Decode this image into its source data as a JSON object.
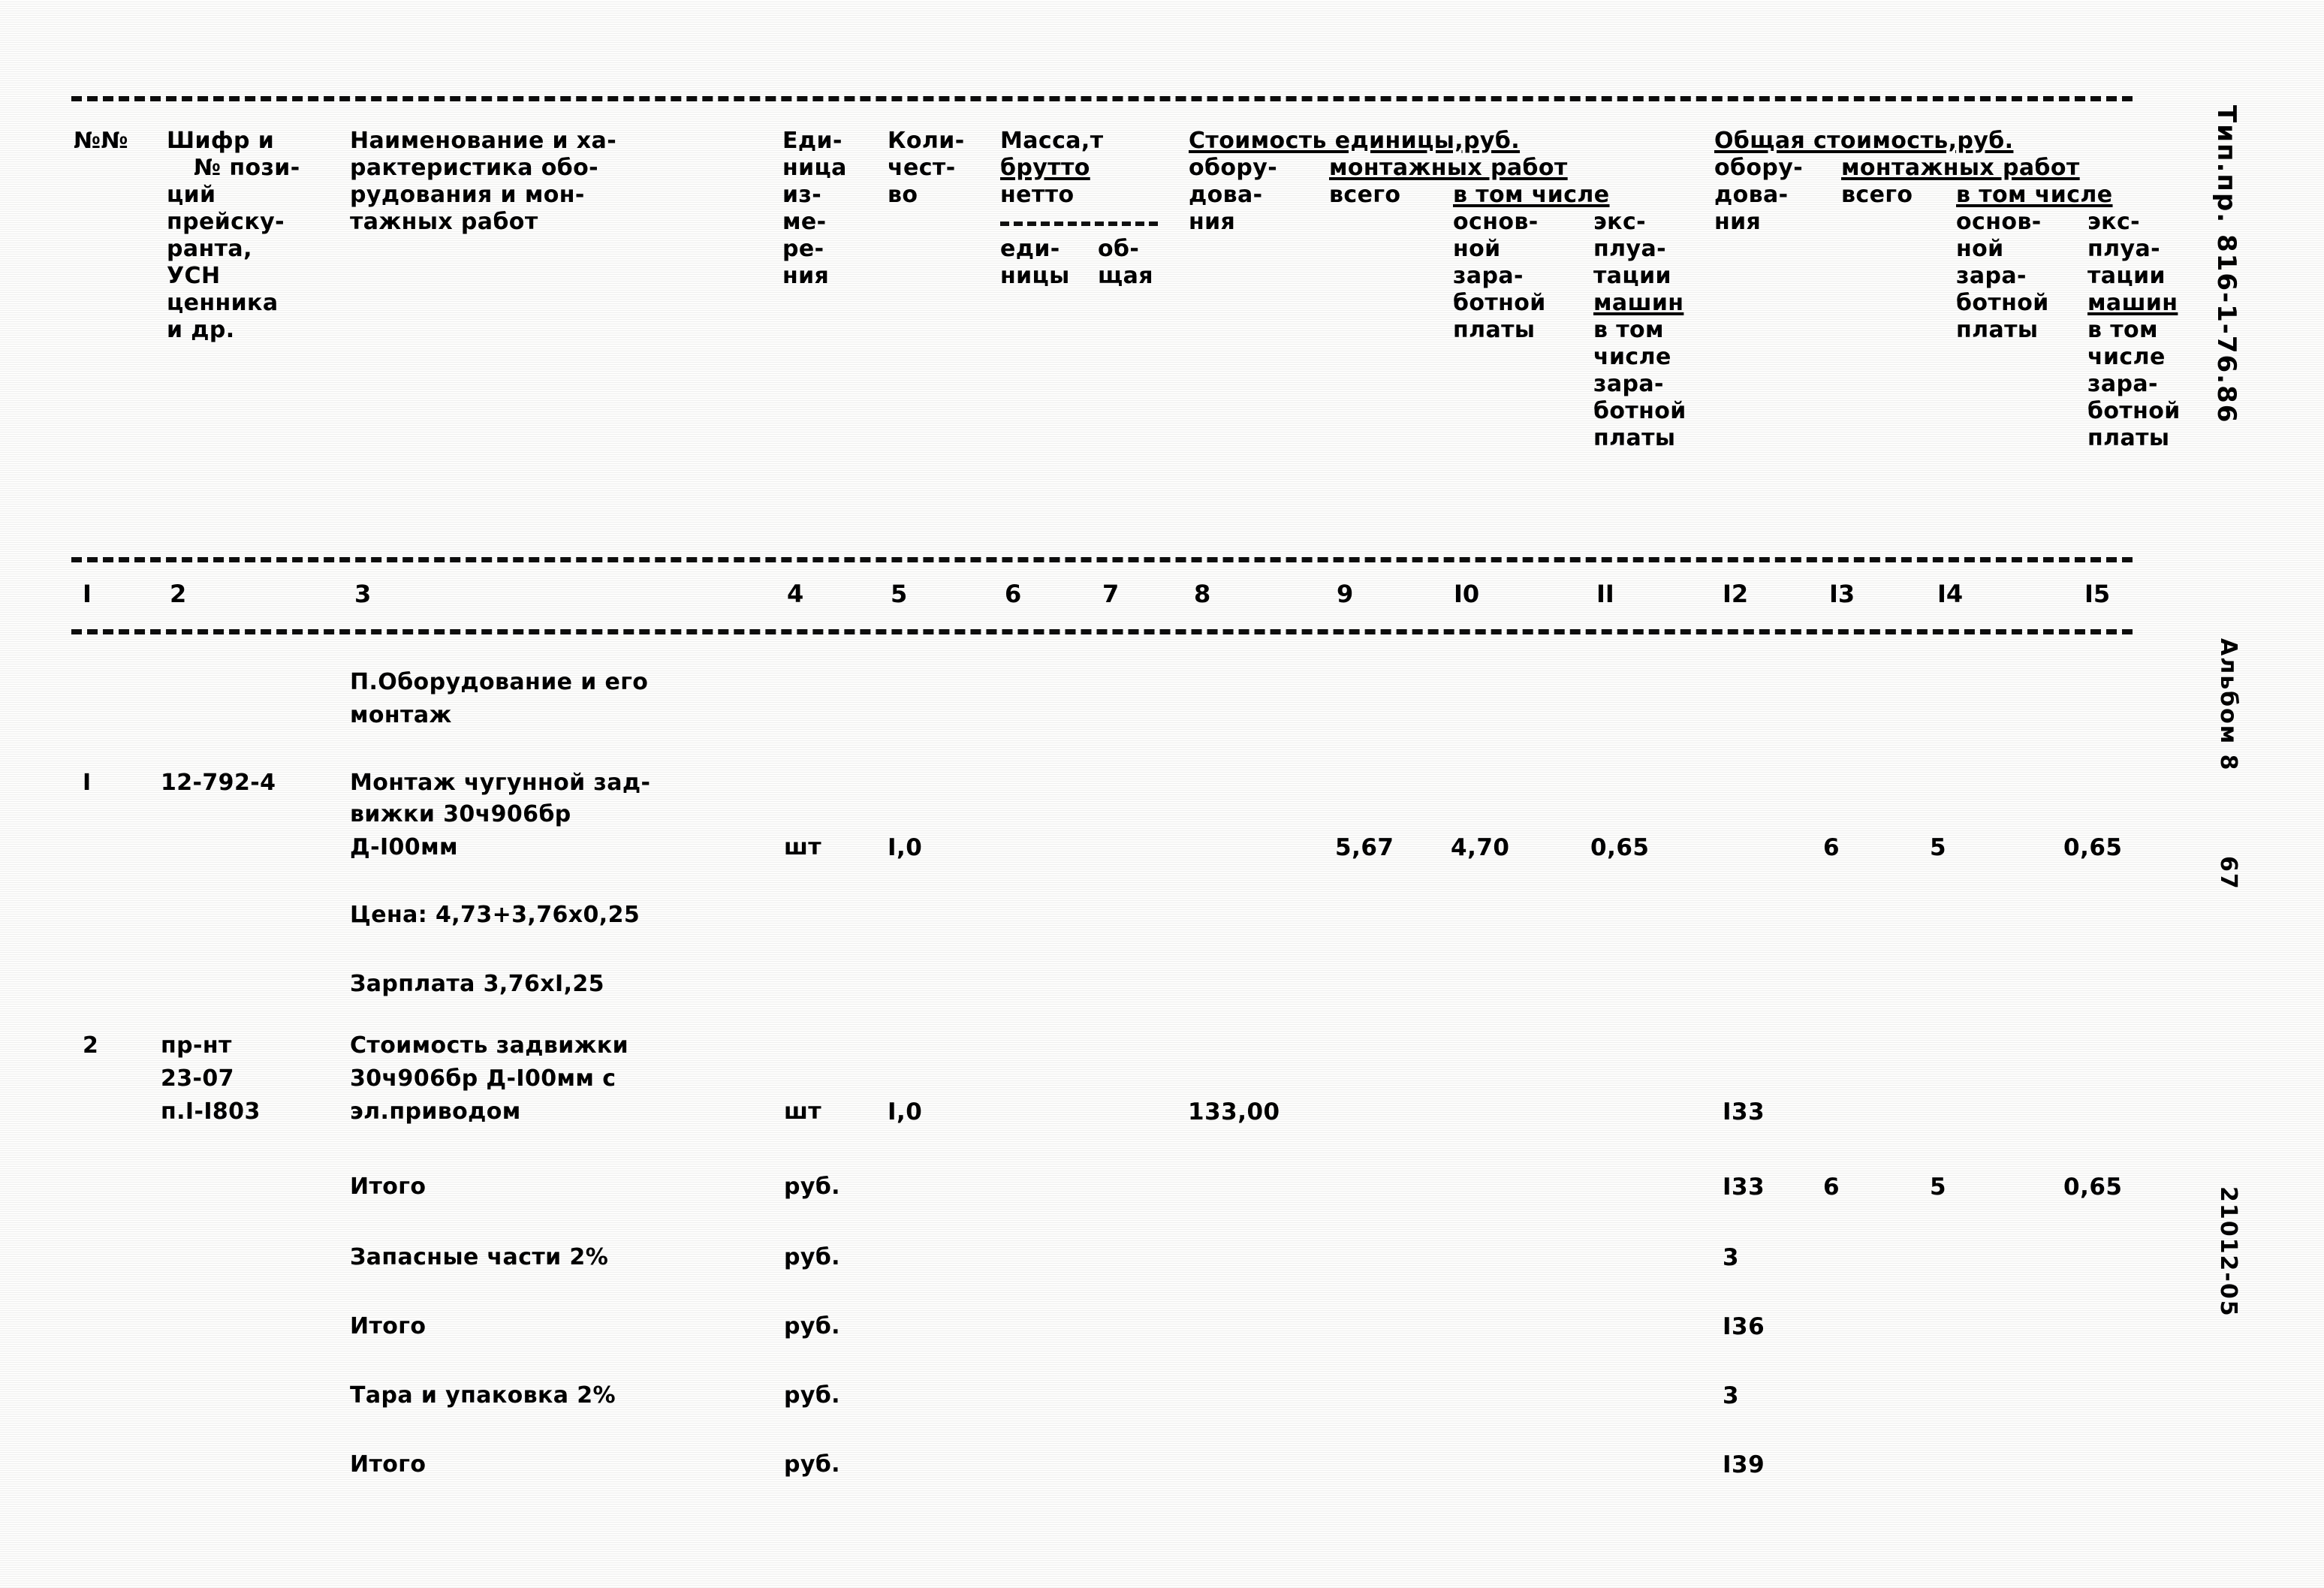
{
  "document": {
    "margin_right": {
      "type_project": "Тип.пр. 816-1-76.86",
      "album": "Альбом 8",
      "page_number": "67",
      "drawing_code": "21012-05"
    }
  },
  "table": {
    "header": {
      "col1": "№№",
      "col2": [
        "Шифр и",
        "№ пози-",
        "ций",
        "прейску-",
        "ранта,",
        "УСН",
        "ценника",
        "и др."
      ],
      "col3": [
        "Наименование и ха-",
        "рактеристика обо-",
        "рудования и мон-",
        "тажных работ"
      ],
      "col4": [
        "Еди-",
        "ница",
        "из-",
        "ме-",
        "ре-",
        "ния"
      ],
      "col5": [
        "Коли-",
        "чест-",
        "во"
      ],
      "col6_7": {
        "title": "Масса,т",
        "line2": "брутто",
        "line3": "нетто",
        "line4_left": "еди-",
        "line4_right": "об-",
        "line5_left": "ницы",
        "line5_right": "щая"
      },
      "unit_cost_group": "Стоимость единицы,руб.",
      "total_cost_group": "Общая стоимость,руб.",
      "col8": [
        "обору-",
        "дова-",
        "ния"
      ],
      "montage_group": "монтажных работ",
      "col9": "всего",
      "in_which": "в том числе",
      "col10": [
        "основ-",
        "ной",
        "зара-",
        "ботной",
        "платы"
      ],
      "col11": [
        "экс-",
        "плуа-",
        "тации",
        "машин",
        "в том",
        "числе",
        "зара-",
        "ботной",
        "платы"
      ],
      "col12": [
        "обору-",
        "дова-",
        "ния"
      ],
      "col13": "всего",
      "col14": [
        "основ-",
        "ной",
        "зара-",
        "ботной",
        "платы"
      ],
      "col15": [
        "экс-",
        "плуа-",
        "тации",
        "машин",
        "в том",
        "числе",
        "зара-",
        "ботной",
        "платы"
      ]
    },
    "column_numbers": [
      "I",
      "2",
      "3",
      "4",
      "5",
      "6",
      "7",
      "8",
      "9",
      "I0",
      "II",
      "I2",
      "I3",
      "I4",
      "I5"
    ],
    "section_title": [
      "П.Оборудование и его",
      "монтаж"
    ],
    "rows": [
      {
        "no": "I",
        "code": [
          "12-792-4"
        ],
        "name": [
          "Монтаж чугунной зад-",
          "вижки 30ч906бр",
          "Д-I00мм"
        ],
        "unit": "шт",
        "qty": "I,0",
        "c8": "",
        "c9": "5,67",
        "c10": "4,70",
        "c11": "0,65",
        "c12": "",
        "c13": "6",
        "c14": "5",
        "c15": "0,65",
        "notes": [
          "Цена: 4,73+3,76х0,25",
          "Зарплата 3,76хI,25"
        ]
      },
      {
        "no": "2",
        "code": [
          "пр-нт",
          "23-07",
          "п.I-I803"
        ],
        "name": [
          "Стоимость задвижки",
          "30ч906бр Д-I00мм с",
          "эл.приводом"
        ],
        "unit": "шт",
        "qty": "I,0",
        "c8": "133,00",
        "c9": "",
        "c10": "",
        "c11": "",
        "c12": "I33",
        "c13": "",
        "c14": "",
        "c15": "",
        "notes": []
      }
    ],
    "summary_rows": [
      {
        "label": "Итого",
        "unit": "руб.",
        "c12": "I33",
        "c13": "6",
        "c14": "5",
        "c15": "0,65"
      },
      {
        "label": "Запасные части 2%",
        "unit": "руб.",
        "c12": "3",
        "c13": "",
        "c14": "",
        "c15": ""
      },
      {
        "label": "Итого",
        "unit": "руб.",
        "c12": "I36",
        "c13": "",
        "c14": "",
        "c15": ""
      },
      {
        "label": "Тара и упаковка 2%",
        "unit": "руб.",
        "c12": "3",
        "c13": "",
        "c14": "",
        "c15": ""
      },
      {
        "label": "Итого",
        "unit": "руб.",
        "c12": "I39",
        "c13": "",
        "c14": "",
        "c15": ""
      }
    ]
  }
}
